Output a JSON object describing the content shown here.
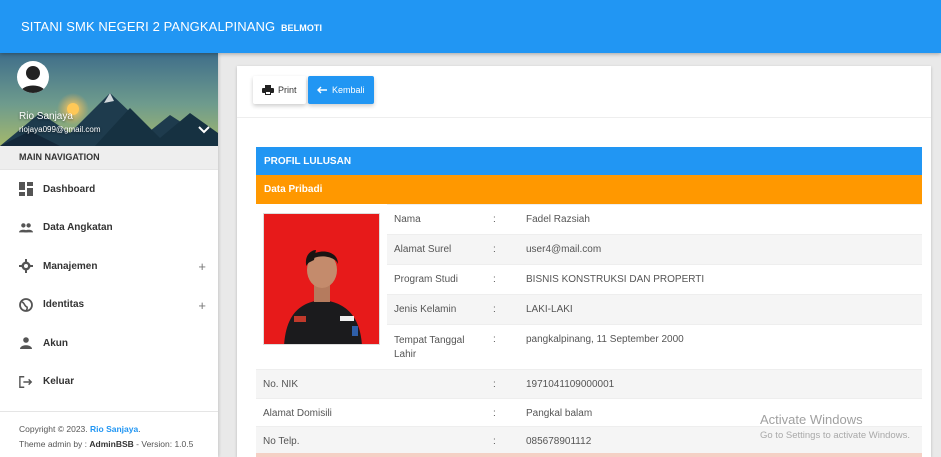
{
  "navbar": {
    "brand": "SITANI SMK NEGERI 2 PANGKALPINANG",
    "brand_suffix": "BELMOTI"
  },
  "user": {
    "name": "Rio Sanjaya",
    "email": "riojaya099@gmail.com"
  },
  "sidebar": {
    "header": "MAIN NAVIGATION",
    "items": [
      {
        "label": "Dashboard",
        "icon": "dashboard-icon"
      },
      {
        "label": "Data Angkatan",
        "icon": "people-icon"
      },
      {
        "label": "Manajemen",
        "icon": "gear-icon",
        "expand": "+"
      },
      {
        "label": "Identitas",
        "icon": "globe-icon",
        "expand": "+"
      },
      {
        "label": "Akun",
        "icon": "person-icon"
      },
      {
        "label": "Keluar",
        "icon": "logout-icon"
      }
    ],
    "footer": {
      "copyright_prefix": "Copyright © 2023.",
      "copyright_name": "Rio Sanjaya",
      "copyright_suffix": ".",
      "theme_prefix": "Theme admin by :",
      "theme_name": "AdminBSB",
      "version": "- Version: 1.0.5"
    }
  },
  "toolbar": {
    "print_label": "Print",
    "back_label": "Kembali"
  },
  "profile": {
    "title": "PROFIL LULUSAN",
    "section": "Data Pribadi",
    "separator": ":",
    "fields": [
      {
        "label": "Nama",
        "value": "Fadel Razsiah"
      },
      {
        "label": "Alamat Surel",
        "value": "user4@mail.com"
      },
      {
        "label": "Program Studi",
        "value": "BISNIS KONSTRUKSI DAN PROPERTI"
      },
      {
        "label": "Jenis Kelamin",
        "value": "LAKI-LAKI"
      },
      {
        "label": "Tempat Tanggal",
        "label2": "Lahir",
        "value": "pangkalpinang, 11 September 2000"
      }
    ],
    "wide_fields": [
      {
        "label": "No. NIK",
        "value": "1971041109000001"
      },
      {
        "label": "Alamat Domisili",
        "value": "Pangkal balam"
      },
      {
        "label": "No Telp.",
        "value": "085678901112"
      }
    ]
  },
  "watermark": {
    "title": "Activate Windows",
    "subtitle": "Go to Settings to activate Windows."
  },
  "colors": {
    "primary": "#2196f3",
    "orange": "#ff9800",
    "photo_bg": "#e71a1a"
  }
}
